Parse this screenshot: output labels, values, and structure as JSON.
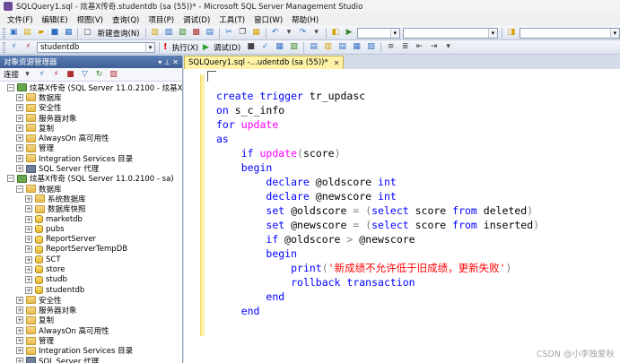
{
  "window": {
    "title": "SQLQuery1.sql - 炫基X传奇.studentdb (sa (55))* - Microsoft SQL Server Management Studio"
  },
  "menu": [
    "文件(F)",
    "编辑(E)",
    "视图(V)",
    "查询(Q)",
    "项目(P)",
    "调试(D)",
    "工具(T)",
    "窗口(W)",
    "帮助(H)"
  ],
  "toolbar": {
    "new_query": "新建查询(N)",
    "database": "studentdb",
    "execute": "执行(X)",
    "debug": "调试(D)"
  },
  "explorer": {
    "title": "对象资源管理器",
    "connect": "连接",
    "pin": "▾ ⊥ ✕",
    "tree": [
      {
        "level": 0,
        "exp": "⊟",
        "icon": "server",
        "label": "炫基X传奇 (SQL Server 11.0.2100 - 炫基X传奇\\31"
      },
      {
        "level": 1,
        "exp": "⊞",
        "icon": "folder",
        "label": "数据库"
      },
      {
        "level": 1,
        "exp": "⊞",
        "icon": "folder",
        "label": "安全性"
      },
      {
        "level": 1,
        "exp": "⊞",
        "icon": "folder",
        "label": "服务器对象"
      },
      {
        "level": 1,
        "exp": "⊞",
        "icon": "folder",
        "label": "复制"
      },
      {
        "level": 1,
        "exp": "⊞",
        "icon": "folder",
        "label": "AlwaysOn 高可用性"
      },
      {
        "level": 1,
        "exp": "⊞",
        "icon": "folder",
        "label": "管理"
      },
      {
        "level": 1,
        "exp": "⊞",
        "icon": "folder",
        "label": "Integration Services 目录"
      },
      {
        "level": 1,
        "exp": "⊞",
        "icon": "agent",
        "label": "SQL Server 代理"
      },
      {
        "level": 0,
        "exp": "⊟",
        "icon": "server",
        "label": "炫基X传奇 (SQL Server 11.0.2100 - sa)"
      },
      {
        "level": 1,
        "exp": "⊟",
        "icon": "folder",
        "label": "数据库"
      },
      {
        "level": 2,
        "exp": "⊞",
        "icon": "folder",
        "label": "系统数据库"
      },
      {
        "level": 2,
        "exp": "⊞",
        "icon": "folder",
        "label": "数据库快照"
      },
      {
        "level": 2,
        "exp": "⊞",
        "icon": "db",
        "label": "marketdb"
      },
      {
        "level": 2,
        "exp": "⊞",
        "icon": "db",
        "label": "pubs"
      },
      {
        "level": 2,
        "exp": "⊞",
        "icon": "db",
        "label": "ReportServer"
      },
      {
        "level": 2,
        "exp": "⊞",
        "icon": "db",
        "label": "ReportServerTempDB"
      },
      {
        "level": 2,
        "exp": "⊞",
        "icon": "db",
        "label": "SCT"
      },
      {
        "level": 2,
        "exp": "⊞",
        "icon": "db",
        "label": "store"
      },
      {
        "level": 2,
        "exp": "⊞",
        "icon": "db",
        "label": "studb"
      },
      {
        "level": 2,
        "exp": "⊞",
        "icon": "db",
        "label": "studentdb"
      },
      {
        "level": 1,
        "exp": "⊞",
        "icon": "folder",
        "label": "安全性"
      },
      {
        "level": 1,
        "exp": "⊞",
        "icon": "folder",
        "label": "服务器对象"
      },
      {
        "level": 1,
        "exp": "⊞",
        "icon": "folder",
        "label": "复制"
      },
      {
        "level": 1,
        "exp": "⊞",
        "icon": "folder",
        "label": "AlwaysOn 高可用性"
      },
      {
        "level": 1,
        "exp": "⊞",
        "icon": "folder",
        "label": "管理"
      },
      {
        "level": 1,
        "exp": "⊞",
        "icon": "folder",
        "label": "Integration Services 目录"
      },
      {
        "level": 1,
        "exp": "⊞",
        "icon": "agent",
        "label": "SQL Server 代理"
      }
    ]
  },
  "editor": {
    "tab_label": "SQLQuery1.sql -...udentdb (sa (55))*",
    "tab_close": "✕",
    "lines": [
      [
        {
          "t": "create trigger ",
          "c": "kw"
        },
        {
          "t": "tr_updasc",
          "c": "id"
        }
      ],
      [
        {
          "t": "on ",
          "c": "kw"
        },
        {
          "t": "s_c_info",
          "c": "id"
        }
      ],
      [
        {
          "t": "for ",
          "c": "kw"
        },
        {
          "t": "update",
          "c": "fn"
        }
      ],
      [
        {
          "t": "as",
          "c": "kw"
        }
      ],
      [
        {
          "t": "    ",
          "c": "id"
        },
        {
          "t": "if ",
          "c": "kw"
        },
        {
          "t": "update",
          "c": "fn"
        },
        {
          "t": "(",
          "c": "op"
        },
        {
          "t": "score",
          "c": "id"
        },
        {
          "t": ")",
          "c": "op"
        }
      ],
      [
        {
          "t": "    ",
          "c": "id"
        },
        {
          "t": "begin",
          "c": "kw"
        }
      ],
      [
        {
          "t": "        ",
          "c": "id"
        },
        {
          "t": "declare ",
          "c": "kw"
        },
        {
          "t": "@oldscore ",
          "c": "id"
        },
        {
          "t": "int",
          "c": "kw"
        }
      ],
      [
        {
          "t": "        ",
          "c": "id"
        },
        {
          "t": "declare ",
          "c": "kw"
        },
        {
          "t": "@newscore ",
          "c": "id"
        },
        {
          "t": "int",
          "c": "kw"
        }
      ],
      [
        {
          "t": "        ",
          "c": "id"
        },
        {
          "t": "set ",
          "c": "kw"
        },
        {
          "t": "@oldscore ",
          "c": "id"
        },
        {
          "t": "= (",
          "c": "op"
        },
        {
          "t": "select ",
          "c": "kw"
        },
        {
          "t": "score ",
          "c": "id"
        },
        {
          "t": "from ",
          "c": "kw"
        },
        {
          "t": "deleted",
          "c": "id"
        },
        {
          "t": ")",
          "c": "op"
        }
      ],
      [
        {
          "t": "        ",
          "c": "id"
        },
        {
          "t": "set ",
          "c": "kw"
        },
        {
          "t": "@newscore ",
          "c": "id"
        },
        {
          "t": "= (",
          "c": "op"
        },
        {
          "t": "select ",
          "c": "kw"
        },
        {
          "t": "score ",
          "c": "id"
        },
        {
          "t": "from ",
          "c": "kw"
        },
        {
          "t": "inserted",
          "c": "id"
        },
        {
          "t": ")",
          "c": "op"
        }
      ],
      [
        {
          "t": "        ",
          "c": "id"
        },
        {
          "t": "if ",
          "c": "kw"
        },
        {
          "t": "@oldscore ",
          "c": "id"
        },
        {
          "t": "> ",
          "c": "op"
        },
        {
          "t": "@newscore",
          "c": "id"
        }
      ],
      [
        {
          "t": "        ",
          "c": "id"
        },
        {
          "t": "begin",
          "c": "kw"
        }
      ],
      [
        {
          "t": "            ",
          "c": "id"
        },
        {
          "t": "print",
          "c": "kw"
        },
        {
          "t": "(",
          "c": "op"
        },
        {
          "t": "'新成绩不允许低于旧成绩，更新失败'",
          "c": "str"
        },
        {
          "t": ")",
          "c": "op"
        }
      ],
      [
        {
          "t": "            ",
          "c": "id"
        },
        {
          "t": "rollback transaction",
          "c": "kw"
        }
      ],
      [
        {
          "t": "        ",
          "c": "id"
        },
        {
          "t": "end",
          "c": "kw"
        }
      ],
      [
        {
          "t": "    ",
          "c": "id"
        },
        {
          "t": "end",
          "c": "kw"
        }
      ]
    ]
  },
  "watermark": "CSDN @小李独爱秋"
}
